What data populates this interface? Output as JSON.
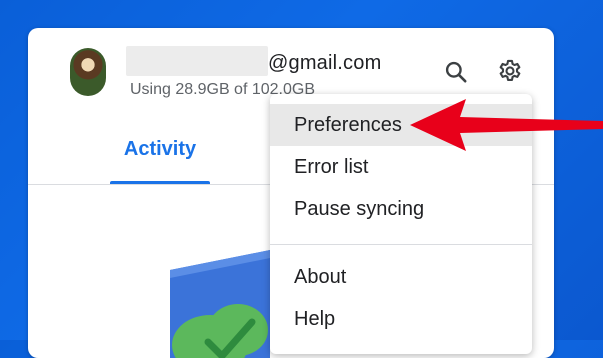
{
  "account": {
    "email_domain": "@gmail.com",
    "storage_usage": "Using 28.9GB of 102.0GB"
  },
  "icons": {
    "search": "search-icon",
    "settings": "gear-icon"
  },
  "tabs": [
    {
      "label": "Activity",
      "active": true
    }
  ],
  "menu": {
    "items": [
      {
        "label": "Preferences",
        "highlighted": true
      },
      {
        "label": "Error list"
      },
      {
        "label": "Pause syncing"
      },
      {
        "label": "About"
      },
      {
        "label": "Help"
      }
    ]
  },
  "colors": {
    "accent": "#1a73e8",
    "annotation_arrow": "#e8001a",
    "desktop_bg": "#0f6ae6"
  }
}
